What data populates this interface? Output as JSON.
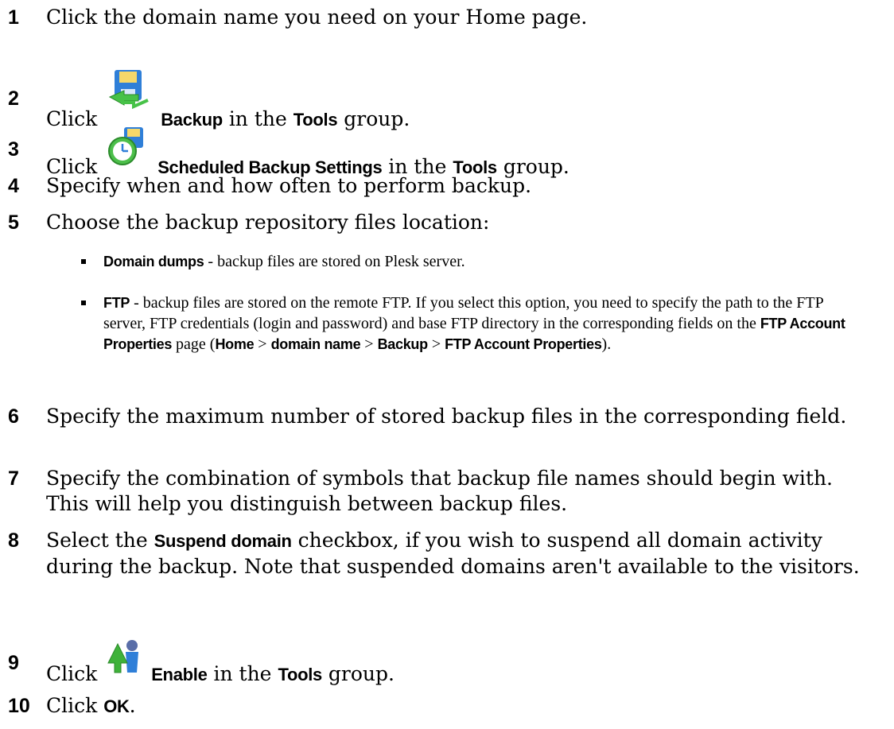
{
  "steps": [
    {
      "num": "1",
      "parts": [
        "Click the domain name you need on your Home page."
      ]
    },
    {
      "num": "2",
      "click": "Click",
      "label": "Backup",
      "in": "in the",
      "group": "Tools",
      "tail": "group."
    },
    {
      "num": "3",
      "click": "Click",
      "label": "Scheduled Backup Settings",
      "in": "in the",
      "group": "Tools",
      "tail": "group."
    },
    {
      "num": "4",
      "text": "Specify when and how often to perform backup."
    },
    {
      "num": "5",
      "text": "Choose the backup repository files location:"
    },
    {
      "num": "6",
      "text": "Specify the maximum number of stored backup files in the corresponding field."
    },
    {
      "num": "7",
      "text": "Specify the combination of symbols that backup file names should begin with. This will help you distinguish between backup files."
    },
    {
      "num": "8",
      "pre": "Select the",
      "label": "Suspend domain",
      "post": "checkbox, if you wish to suspend all domain activity during the backup. Note that suspended domains aren't available to the visitors."
    },
    {
      "num": "9",
      "click": "Click",
      "label": "Enable",
      "in": "in the",
      "group": "Tools",
      "tail": "group."
    },
    {
      "num": "10",
      "click": "Click",
      "label": "OK",
      "tail": "."
    }
  ],
  "bullets": [
    {
      "label": "Domain dumps",
      "text": " - backup files are stored on Plesk server."
    },
    {
      "label": "FTP",
      "text": " - backup files are stored on the remote FTP.  If you select this option, you need to specify the path to the FTP server, FTP credentials (login and password) and base FTP directory in the corresponding fields on the",
      "page_label": "FTP Account Properties",
      "page_word": "page (",
      "path": [
        "Home",
        "domain name",
        "Backup",
        "FTP Account Properties"
      ],
      "sep": " > ",
      "end": ")."
    }
  ],
  "icons": {
    "backup": "backup-floppy-arrow-icon",
    "scheduled": "scheduled-backup-clock-icon",
    "enable": "enable-arrow-user-icon"
  }
}
